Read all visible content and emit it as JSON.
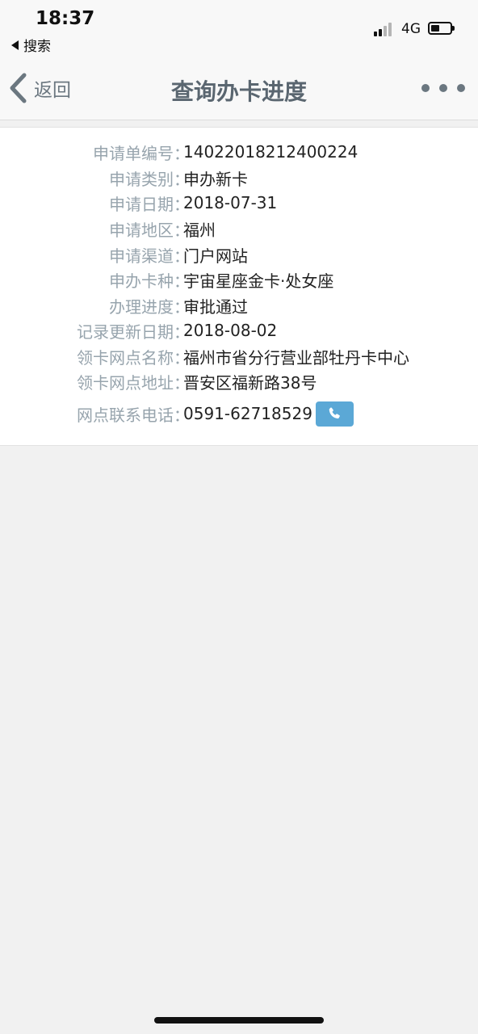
{
  "status_bar": {
    "time": "18:37",
    "back_app": "搜索",
    "network": "4G",
    "battery_level": 0.45
  },
  "nav": {
    "back_label": "返回",
    "title": "查询办卡进度",
    "more_icon": "more-dots-icon"
  },
  "details": {
    "rows": [
      {
        "label": "申请单编号",
        "value": "14022018212400224"
      },
      {
        "label": "申请类别",
        "value": "申办新卡"
      },
      {
        "label": "申请日期",
        "value": "2018-07-31"
      },
      {
        "label": "申请地区",
        "value": "福州"
      },
      {
        "label": "申请渠道",
        "value": "门户网站"
      },
      {
        "label": "申办卡种",
        "value": "宇宙星座金卡·处女座"
      },
      {
        "label": "办理进度",
        "value": "审批通过"
      },
      {
        "label": "记录更新日期",
        "value": "2018-08-02"
      },
      {
        "label": "领卡网点名称",
        "value": "福州市省分行营业部牡丹卡中心"
      },
      {
        "label": "领卡网点地址",
        "value": "晋安区福新路38号"
      },
      {
        "label": "网点联系电话",
        "value": "0591-62718529"
      }
    ],
    "colon": "："
  },
  "colors": {
    "label": "#97a4ad",
    "value": "#222222",
    "phone_button": "#5ba8d6",
    "nav_text": "#5a6670",
    "background": "#f1f1f1"
  }
}
